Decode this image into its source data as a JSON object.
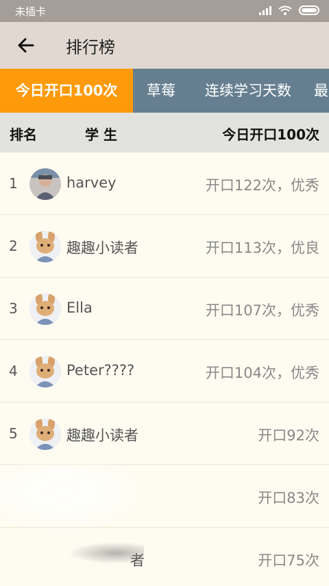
{
  "status_bar": {
    "carrier": "未插卡"
  },
  "app_bar": {
    "title": "排行榜"
  },
  "tabs": [
    {
      "label": "今日开口100次",
      "active": true
    },
    {
      "label": "草莓",
      "active": false
    },
    {
      "label": "连续学习天数",
      "active": false
    },
    {
      "label": "最",
      "active": false
    }
  ],
  "table_header": {
    "rank": "排名",
    "student": "学 生",
    "count": "今日开口100次"
  },
  "rows": [
    {
      "rank": "1",
      "name": "harvey",
      "score": "开口122次，优秀",
      "avatar": "child-photo"
    },
    {
      "rank": "2",
      "name": "趣趣小读者",
      "score": "开口113次，优良",
      "avatar": "rabbit"
    },
    {
      "rank": "3",
      "name": "Ella",
      "score": "开口107次，优秀",
      "avatar": "rabbit"
    },
    {
      "rank": "4",
      "name": "Peter????",
      "score": "开口104次，优秀",
      "avatar": "rabbit"
    },
    {
      "rank": "5",
      "name": "趣趣小读者",
      "score": "开口92次",
      "avatar": "rabbit"
    },
    {
      "rank": "",
      "name": "",
      "score": "开口83次",
      "avatar": ""
    },
    {
      "rank": "",
      "name": "者",
      "score": "开口75次",
      "avatar": ""
    }
  ],
  "colors": {
    "tab_active": "#ff9a0a",
    "tab_bar": "#667f90",
    "app_bar": "#e1d9d1",
    "status_bar": "#a59e98"
  }
}
